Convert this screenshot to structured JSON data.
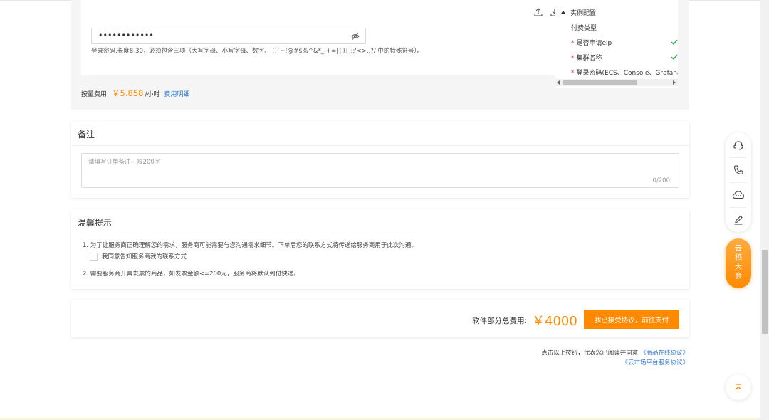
{
  "config": {
    "password_masked": "••••••••••••",
    "password_hint": "登录密码,长度8-30，必须包含三项（大写字母、小写字母、数字、 ()`~!@#$%^&*_-+=|{}[]:;'<>,.?/ 中的特殊符号）。",
    "fee_label": "按量费用:",
    "fee_price": "￥5.858",
    "fee_unit": "/小时",
    "fee_detail_link": "费用明细"
  },
  "tree": {
    "root": "实例配置",
    "items": [
      {
        "label": "付费类型",
        "required": false,
        "checked": false
      },
      {
        "label": "是否申请eip",
        "required": true,
        "checked": true
      },
      {
        "label": "集群名称",
        "required": true,
        "checked": true
      },
      {
        "label": "登录密码(ECS、Console、Grafana、",
        "required": true,
        "checked": false
      }
    ]
  },
  "remark": {
    "title": "备注",
    "placeholder": "请填写订单备注，限200字",
    "counter": "0/200"
  },
  "tips": {
    "title": "温馨提示",
    "line1": "1. 为了让服务商正确理解您的需求，服务商可能需要与您沟通需求细节。下单后您的联系方式将传递给服务商用于此次沟通。",
    "checkbox_label": "我同意告知服务商我的联系方式",
    "line2": "2. 需要服务商开具发票的商品，如发票金额<=200元，服务商将默认到付快递。"
  },
  "payment": {
    "label": "软件部分总费用:",
    "amount": "￥4000",
    "button": "我已接受协议，前往支付"
  },
  "agreement": {
    "prefix": "点击以上按钮，代表您已阅读并同意",
    "link1": "《商品在线协议》",
    "link2": "《云市场平台服务协议》"
  },
  "sidebar": {
    "promo": [
      "云",
      "栖",
      "大",
      "会"
    ]
  },
  "colors": {
    "accent": "#ff8a00",
    "link": "#2f77d1",
    "required": "#e64545",
    "check": "#2fa84f"
  }
}
